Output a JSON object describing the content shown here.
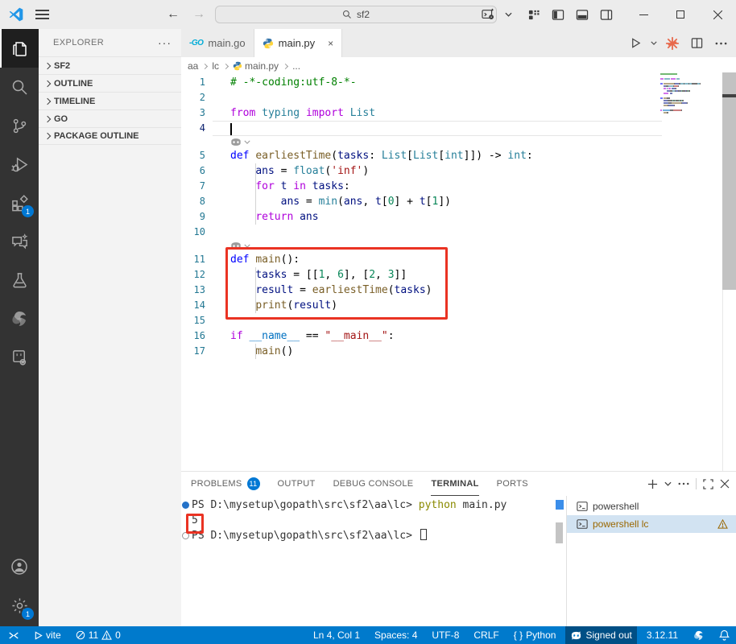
{
  "title_bar": {
    "menu_icon": "hamburger-icon",
    "back_icon": "arrow-left-icon",
    "forward_icon": "arrow-right-icon",
    "search": {
      "placeholder": "",
      "value": "sf2",
      "icon": "search-icon"
    },
    "window": {
      "minimize": "minimize-icon",
      "maximize": "maximize-icon",
      "close": "close-icon"
    }
  },
  "activity_bar": {
    "items": [
      "explorer",
      "search",
      "source-control",
      "run-debug",
      "extensions",
      "chat",
      "testing",
      "swirl-extension",
      "file-code-gear"
    ],
    "extensions_badge": "1",
    "settings_badge": "1"
  },
  "sidebar": {
    "title": "EXPLORER",
    "more_label": "···",
    "sections": [
      {
        "label": "SF2"
      },
      {
        "label": "OUTLINE"
      },
      {
        "label": "TIMELINE"
      },
      {
        "label": "GO"
      },
      {
        "label": "PACKAGE OUTLINE"
      }
    ]
  },
  "tabs": [
    {
      "label": "main.go",
      "icon": "go-icon",
      "active": false
    },
    {
      "label": "main.py",
      "icon": "python-icon",
      "active": true,
      "close": "×"
    }
  ],
  "breadcrumb": {
    "items": [
      "aa",
      "lc",
      "main.py",
      "..."
    ]
  },
  "editor": {
    "token_colors": {
      "comment": "#008000",
      "kw": "#AF00DB",
      "def": "#0000FF",
      "fn": "#795E26",
      "type": "#267F99",
      "var": "#001080",
      "num": "#098658",
      "str": "#A31515",
      "const": "#0070C1",
      "plain": "#000000"
    },
    "lines": [
      {
        "n": 1,
        "t": [
          [
            "# -*-coding:utf-8-*-",
            "comment"
          ]
        ]
      },
      {
        "n": 2,
        "t": []
      },
      {
        "n": 3,
        "t": [
          [
            "from",
            "kw"
          ],
          [
            " ",
            "plain"
          ],
          [
            "typing",
            "type"
          ],
          [
            " ",
            "plain"
          ],
          [
            "import",
            "kw"
          ],
          [
            " ",
            "plain"
          ],
          [
            "List",
            "type"
          ]
        ]
      },
      {
        "n": 4,
        "t": [],
        "current": true,
        "cursor": true
      },
      {
        "w": "copilot"
      },
      {
        "n": 5,
        "t": [
          [
            "def",
            "def"
          ],
          [
            " ",
            "plain"
          ],
          [
            "earliestTime",
            "fn"
          ],
          [
            "(",
            "plain"
          ],
          [
            "tasks",
            "var"
          ],
          [
            ": ",
            "plain"
          ],
          [
            "List",
            "type"
          ],
          [
            "[",
            "plain"
          ],
          [
            "List",
            "type"
          ],
          [
            "[",
            "plain"
          ],
          [
            "int",
            "type"
          ],
          [
            "]]) -> ",
            "plain"
          ],
          [
            "int",
            "type"
          ],
          [
            ":",
            "plain"
          ]
        ]
      },
      {
        "n": 6,
        "g": 1,
        "t": [
          [
            "    ",
            "plain"
          ],
          [
            "ans",
            "var"
          ],
          [
            " = ",
            "plain"
          ],
          [
            "float",
            "type"
          ],
          [
            "(",
            "plain"
          ],
          [
            "'inf'",
            "str"
          ],
          [
            ")",
            "plain"
          ]
        ]
      },
      {
        "n": 7,
        "g": 1,
        "t": [
          [
            "    ",
            "plain"
          ],
          [
            "for",
            "kw"
          ],
          [
            " ",
            "plain"
          ],
          [
            "t",
            "var"
          ],
          [
            " ",
            "plain"
          ],
          [
            "in",
            "kw"
          ],
          [
            " ",
            "plain"
          ],
          [
            "tasks",
            "var"
          ],
          [
            ":",
            "plain"
          ]
        ]
      },
      {
        "n": 8,
        "g": 1,
        "t": [
          [
            "        ",
            "plain"
          ],
          [
            "ans",
            "var"
          ],
          [
            " = ",
            "plain"
          ],
          [
            "min",
            "type"
          ],
          [
            "(",
            "plain"
          ],
          [
            "ans",
            "var"
          ],
          [
            ", ",
            "plain"
          ],
          [
            "t",
            "var"
          ],
          [
            "[",
            "plain"
          ],
          [
            "0",
            "num"
          ],
          [
            "] + ",
            "plain"
          ],
          [
            "t",
            "var"
          ],
          [
            "[",
            "plain"
          ],
          [
            "1",
            "num"
          ],
          [
            "])",
            "plain"
          ]
        ]
      },
      {
        "n": 9,
        "g": 1,
        "t": [
          [
            "    ",
            "plain"
          ],
          [
            "return",
            "kw"
          ],
          [
            " ",
            "plain"
          ],
          [
            "ans",
            "var"
          ]
        ]
      },
      {
        "n": 10,
        "t": []
      },
      {
        "w": "copilot"
      },
      {
        "n": 11,
        "t": [
          [
            "def",
            "def"
          ],
          [
            " ",
            "plain"
          ],
          [
            "main",
            "fn"
          ],
          [
            "():",
            "plain"
          ]
        ]
      },
      {
        "n": 12,
        "g": 1,
        "t": [
          [
            "    ",
            "plain"
          ],
          [
            "tasks",
            "var"
          ],
          [
            " = [[",
            "plain"
          ],
          [
            "1",
            "num"
          ],
          [
            ", ",
            "plain"
          ],
          [
            "6",
            "num"
          ],
          [
            "], [",
            "plain"
          ],
          [
            "2",
            "num"
          ],
          [
            ", ",
            "plain"
          ],
          [
            "3",
            "num"
          ],
          [
            "]]",
            "plain"
          ]
        ]
      },
      {
        "n": 13,
        "g": 1,
        "t": [
          [
            "    ",
            "plain"
          ],
          [
            "result",
            "var"
          ],
          [
            " = ",
            "plain"
          ],
          [
            "earliestTime",
            "fn"
          ],
          [
            "(",
            "plain"
          ],
          [
            "tasks",
            "var"
          ],
          [
            ")",
            "plain"
          ]
        ]
      },
      {
        "n": 14,
        "g": 1,
        "t": [
          [
            "    ",
            "plain"
          ],
          [
            "print",
            "fn"
          ],
          [
            "(",
            "plain"
          ],
          [
            "result",
            "var"
          ],
          [
            ")",
            "plain"
          ]
        ]
      },
      {
        "n": 15,
        "t": []
      },
      {
        "n": 16,
        "t": [
          [
            "if",
            "kw"
          ],
          [
            " ",
            "plain"
          ],
          [
            "__name__",
            "const"
          ],
          [
            " == ",
            "plain"
          ],
          [
            "\"__main__\"",
            "str"
          ],
          [
            ":",
            "plain"
          ]
        ]
      },
      {
        "n": 17,
        "g": 1,
        "t": [
          [
            "    ",
            "plain"
          ],
          [
            "main",
            "fn"
          ],
          [
            "()",
            "plain"
          ]
        ]
      }
    ],
    "annotation_color": "#ea3323"
  },
  "panel": {
    "tabs": [
      {
        "label": "PROBLEMS",
        "badge": "11",
        "active": false
      },
      {
        "label": "OUTPUT",
        "active": false
      },
      {
        "label": "DEBUG CONSOLE",
        "active": false
      },
      {
        "label": "TERMINAL",
        "active": true
      },
      {
        "label": "PORTS",
        "active": false
      }
    ],
    "terminal": {
      "colors": {
        "plain": "#333333",
        "cmd": "#8a8a00"
      },
      "lines": [
        {
          "deco": "filled",
          "t": [
            [
              "PS D:\\mysetup\\gopath\\src\\sf2\\aa\\lc> ",
              "plain"
            ],
            [
              "python",
              "cmd"
            ],
            [
              " main.py",
              "plain"
            ]
          ]
        },
        {
          "deco": null,
          "boxed": true,
          "t": [
            [
              "5",
              "plain"
            ]
          ]
        },
        {
          "deco": "outline",
          "cursor": true,
          "t": [
            [
              "PS D:\\mysetup\\gopath\\src\\sf2\\aa\\lc> ",
              "plain"
            ]
          ]
        }
      ]
    },
    "terminal_list": [
      {
        "label": "powershell",
        "selected": false,
        "warning": false
      },
      {
        "label": "powershell lc",
        "selected": true,
        "warning": true
      }
    ]
  },
  "status_bar": {
    "vite_label": "vite",
    "errors": "11",
    "warnings": "0",
    "cursor_position": "Ln 4, Col 1",
    "indentation": "Spaces: 4",
    "encoding": "UTF-8",
    "eol": "CRLF",
    "braces": "{ }",
    "language": "Python",
    "copilot_status": "Signed out",
    "python_version": "3.12.11"
  }
}
